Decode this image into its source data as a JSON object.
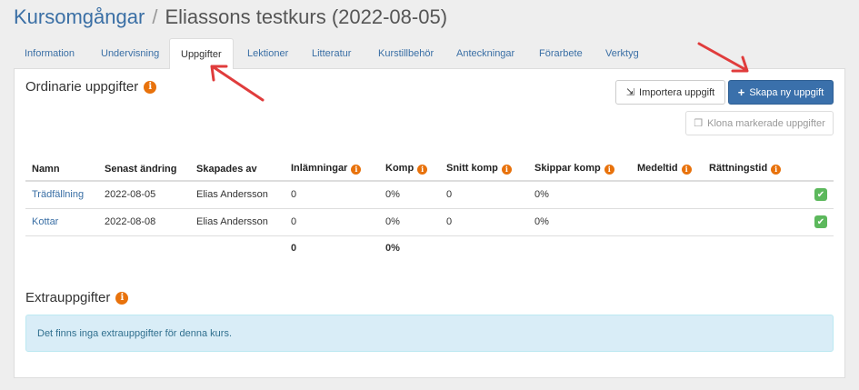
{
  "header": {
    "breadcrumb_root": "Kursomgångar",
    "separator": "/",
    "course_title": "Eliassons testkurs (2022-08-05)"
  },
  "tabs": [
    {
      "label": "Information"
    },
    {
      "label": "Undervisning"
    },
    {
      "label": "Uppgifter",
      "active": true
    },
    {
      "label": "Lektioner"
    },
    {
      "label": "Litteratur"
    },
    {
      "label": "Kurstillbehör"
    },
    {
      "label": "Anteckningar"
    },
    {
      "label": "Förarbete"
    },
    {
      "label": "Verktyg"
    }
  ],
  "ordinary": {
    "title": "Ordinarie uppgifter",
    "import_button": "Importera uppgift",
    "create_button": "Skapa ny uppgift",
    "clone_button": "Klona markerade uppgifter",
    "columns": [
      "Namn",
      "Senast ändring",
      "Skapades av",
      "Inlämningar",
      "Komp",
      "Snitt komp",
      "Skippar komp",
      "Medeltid",
      "Rättningstid"
    ],
    "rows": [
      {
        "name": "Trädfällning",
        "changed": "2022-08-05",
        "created_by": "Elias Andersson",
        "submissions": "0",
        "comp": "0%",
        "avg_comp": "0",
        "skip_comp": "0%",
        "avg_time": "",
        "grading_time": "",
        "checked": true
      },
      {
        "name": "Kottar",
        "changed": "2022-08-08",
        "created_by": "Elias Andersson",
        "submissions": "0",
        "comp": "0%",
        "avg_comp": "0",
        "skip_comp": "0%",
        "avg_time": "",
        "grading_time": "",
        "checked": true
      }
    ],
    "totals": {
      "submissions": "0",
      "comp": "0%"
    }
  },
  "extra": {
    "title": "Extrauppgifter",
    "empty_message": "Det finns inga extrauppgifter för denna kurs."
  },
  "icons": {
    "info": "info-icon",
    "import": "import-icon",
    "plus": "plus-icon",
    "clone": "clone-icon",
    "check": "checkbox-checked-icon"
  },
  "colors": {
    "link": "#3a6fa5",
    "primary": "#3a70ab",
    "info_orange": "#e8720c",
    "check_green": "#5cb85c",
    "alert_bg": "#d9edf7",
    "annotation_arrow": "#e03c3c"
  }
}
